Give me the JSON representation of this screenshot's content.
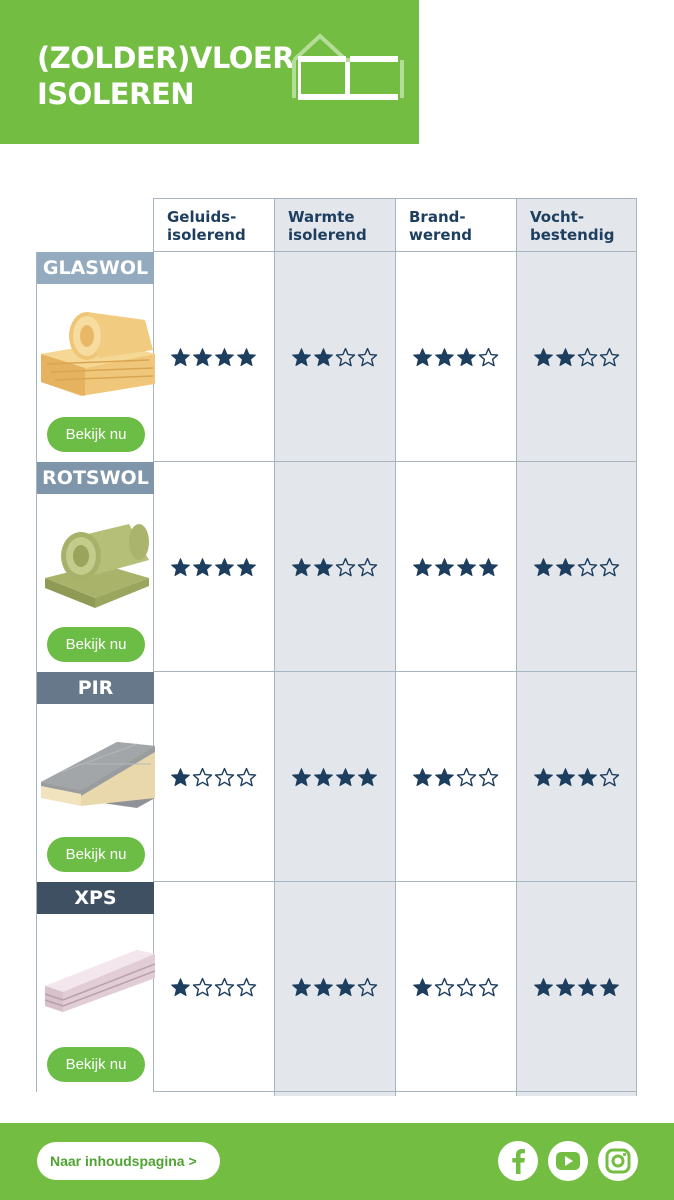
{
  "header": {
    "title_line1": "(ZOLDER)VLOER",
    "title_line2": "ISOLEREN"
  },
  "columns": [
    {
      "line1": "Geluids-",
      "line2": "isolerend"
    },
    {
      "line1": "Warmte",
      "line2": "isolerend"
    },
    {
      "line1": "Brand-",
      "line2": "werend"
    },
    {
      "line1": "Vocht-",
      "line2": "bestendig"
    }
  ],
  "products": [
    {
      "name": "GLASWOL",
      "label_color": "#94abbf",
      "button": "Bekijk nu",
      "ratings": [
        4,
        2,
        3,
        2
      ]
    },
    {
      "name": "ROTSWOL",
      "label_color": "#7f96aa",
      "button": "Bekijk nu",
      "ratings": [
        4,
        2,
        4,
        2
      ]
    },
    {
      "name": "PIR",
      "label_color": "#66788a",
      "button": "Bekijk nu",
      "ratings": [
        1,
        4,
        2,
        3
      ]
    },
    {
      "name": "XPS",
      "label_color": "#3f5063",
      "button": "Bekijk nu",
      "ratings": [
        1,
        3,
        1,
        4
      ]
    }
  ],
  "rating_max": 4,
  "footer": {
    "back_button": "Naar inhoudspagina >",
    "social_icons": [
      "facebook-icon",
      "youtube-icon",
      "instagram-icon"
    ]
  },
  "colors": {
    "brand_green": "#74bd43",
    "star_blue": "#1d3e5e",
    "column_shade": "#e3e7ec"
  }
}
